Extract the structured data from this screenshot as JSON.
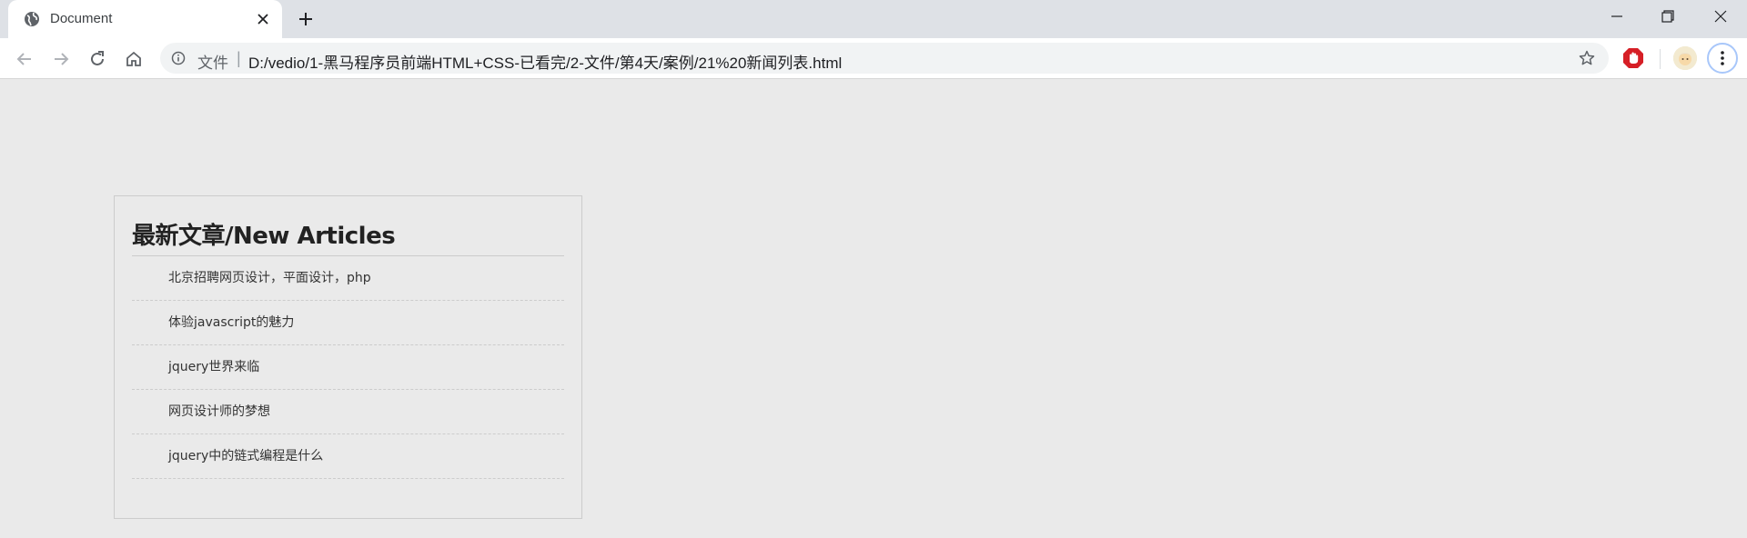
{
  "browser": {
    "tab": {
      "title": "Document"
    },
    "omnibox": {
      "label": "文件",
      "separator": "|",
      "url": "D:/vedio/1-黑马程序员前端HTML+CSS-已看完/2-文件/第4天/案例/21%20新闻列表.html"
    }
  },
  "page": {
    "title": "最新文章/New Articles",
    "articles": [
      "北京招聘网页设计，平面设计，php",
      "体验javascript的魅力",
      "jquery世界来临",
      "网页设计师的梦想",
      "jquery中的链式编程是什么"
    ]
  },
  "colors": {
    "tabstrip": "#dee1e6",
    "page_background": "#eaeaea",
    "box_border": "#cccccc",
    "title_text": "#222222",
    "item_text": "#333333",
    "extension_red": "#d61f26"
  }
}
